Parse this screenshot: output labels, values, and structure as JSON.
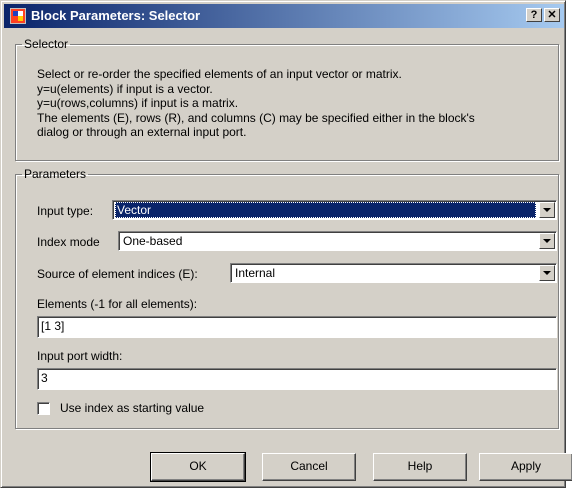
{
  "window": {
    "title": "Block Parameters: Selector",
    "help_button": "?",
    "close_button": "✕"
  },
  "selector_group": {
    "legend": "Selector",
    "description_lines": [
      "Select or re-order the specified elements of an input vector or matrix.",
      "y=u(elements) if input is a vector.",
      "y=u(rows,columns) if input is a matrix.",
      "The elements (E), rows (R), and columns (C) may be specified either in the block's",
      "dialog or through an external input port."
    ]
  },
  "parameters_group": {
    "legend": "Parameters",
    "input_type": {
      "label": "Input type:",
      "value": "Vector"
    },
    "index_mode": {
      "label": "Index mode",
      "value": "One-based"
    },
    "source_indices": {
      "label": "Source of element indices (E):",
      "value": "Internal"
    },
    "elements": {
      "label": "Elements (-1 for all elements):",
      "value": "[1 3]"
    },
    "input_port_width": {
      "label": "Input port width:",
      "value": "3"
    },
    "use_index_checkbox": {
      "label": "Use index as starting value",
      "checked": false
    }
  },
  "buttons": {
    "ok": "OK",
    "cancel": "Cancel",
    "help": "Help",
    "apply": "Apply"
  },
  "colors": {
    "title_gradient_start": "#0a246a",
    "title_gradient_end": "#a6caf0",
    "dialog_face": "#d4d0c8",
    "selection": "#0a246a"
  }
}
